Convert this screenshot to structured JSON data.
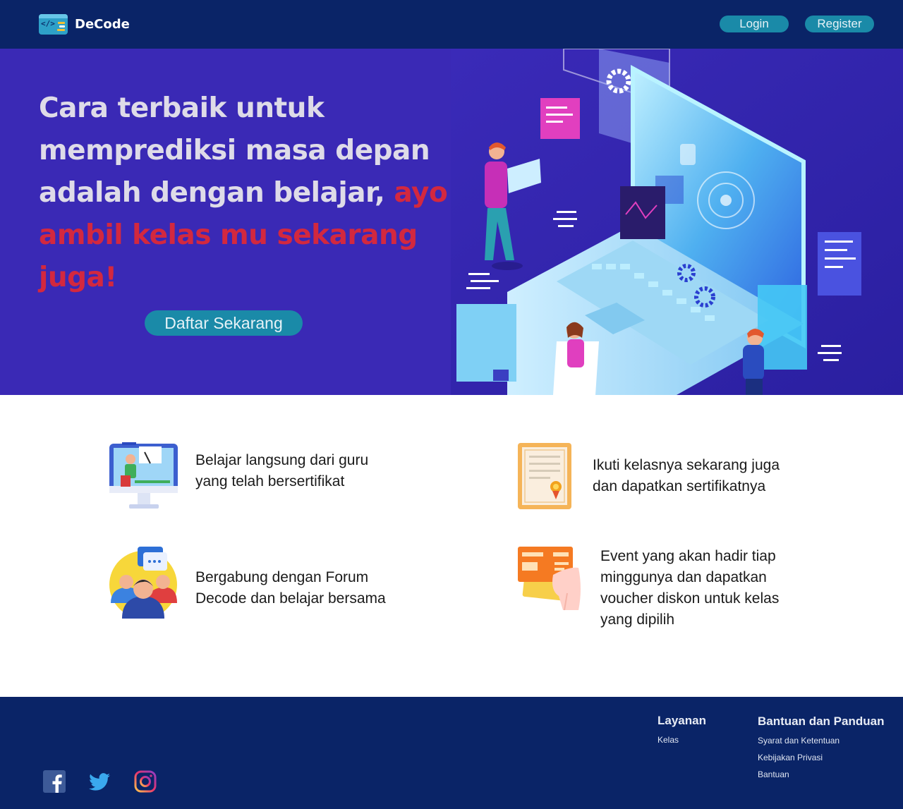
{
  "brand": {
    "name": "DeCode",
    "logo_icon": "code-window-icon"
  },
  "nav": {
    "login_label": "Login",
    "register_label": "Register"
  },
  "hero": {
    "title_part1": "Cara terbaik untuk memprediksi masa depan adalah dengan belajar, ",
    "title_accent": "ayo ambil kelas mu sekarang juga!",
    "cta_label": "Daftar Sekarang",
    "illustration": "isometric-laptop-learning-illustration"
  },
  "features": [
    {
      "icon": "teacher-monitor-icon",
      "text_line1": "Belajar langsung dari guru",
      "text_line2": "yang telah bersertifikat"
    },
    {
      "icon": "certificate-icon",
      "text_line1": "Ikuti kelasnya sekarang juga",
      "text_line2": "dan dapatkan sertifikatnya"
    },
    {
      "icon": "forum-group-icon",
      "text_line1": "Bergabung dengan Forum",
      "text_line2": "Decode dan belajar bersama"
    },
    {
      "icon": "voucher-hand-icon",
      "text_line1": "Event yang akan hadir tiap",
      "text_line2": "minggunya dan dapatkan",
      "text_line3": "voucher diskon untuk kelas",
      "text_line4": "yang dipilih"
    }
  ],
  "footer": {
    "layanan": {
      "title": "Layanan",
      "links": [
        "Kelas"
      ]
    },
    "bantuan": {
      "title": "Bantuan dan Panduan",
      "links": [
        "Syarat dan Ketentuan",
        "Kebijakan Privasi",
        "Bantuan"
      ]
    },
    "social": [
      "facebook-icon",
      "twitter-icon",
      "instagram-icon"
    ]
  },
  "colors": {
    "navbar": "#0a2467",
    "hero_bg": "#3a29b5",
    "accent_red": "#d3283f",
    "button": "#1a8aa8"
  }
}
